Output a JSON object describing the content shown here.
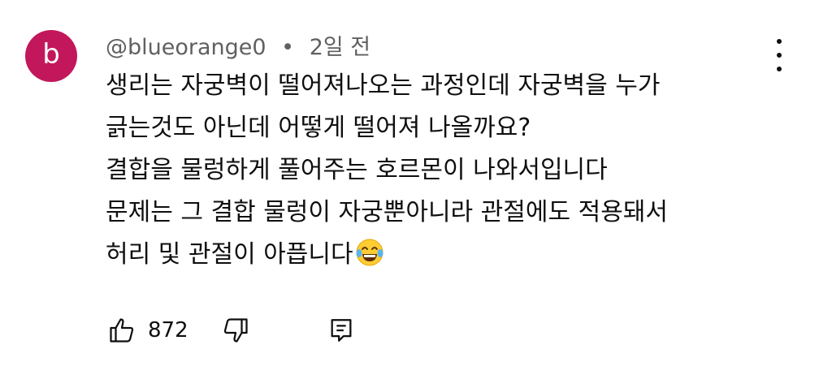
{
  "comment": {
    "avatar_letter": "b",
    "avatar_color": "#c2185b",
    "author": "@blueorange0",
    "separator": "•",
    "time": "2일 전",
    "lines": [
      "생리는 자궁벽이 떨어져나오는 과정인데 자궁벽을 누가",
      "긁는것도 아닌데 어떻게 떨어져 나올까요?",
      "결합을 물렁하게 풀어주는 호르몬이 나와서입니다",
      "문제는 그 결합 물렁이 자궁뿐아니라 관절에도 적용돼서",
      "허리 및 관절이 아픕니다"
    ],
    "trailing_emoji": "face-with-tears-of-joy-emoji",
    "like_count": "872",
    "icons": {
      "like": "thumbs-up-icon",
      "dislike": "thumbs-down-icon",
      "reply": "comment-reply-icon",
      "more": "more-vertical-icon"
    }
  }
}
